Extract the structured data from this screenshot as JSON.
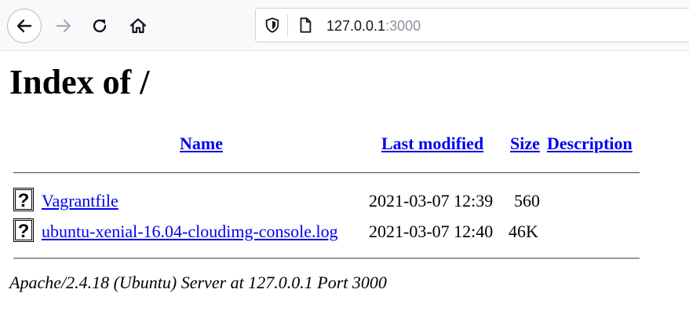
{
  "browser": {
    "url_host": "127.0.0.1",
    "url_port": ":3000",
    "icons": [
      "back-arrow-icon",
      "forward-arrow-icon",
      "reload-icon",
      "home-icon",
      "shield-icon",
      "page-icon"
    ]
  },
  "page": {
    "title": "Index of /",
    "columns": {
      "name": "Name",
      "last_modified": "Last modified",
      "size": "Size",
      "description": "Description"
    },
    "rows": [
      {
        "name": "Vagrantfile",
        "last_modified": "2021-03-07 12:39",
        "size": "560",
        "description": "",
        "icon": "unknown-file-icon"
      },
      {
        "name": "ubuntu-xenial-16.04-cloudimg-console.log",
        "last_modified": "2021-03-07 12:40",
        "size": "46K",
        "description": "",
        "icon": "unknown-file-icon"
      }
    ],
    "footer": "Apache/2.4.18 (Ubuntu) Server at 127.0.0.1 Port 3000"
  },
  "colors": {
    "link": "#0000ee",
    "toolbar_bg": "#f9f9fb",
    "url_port": "#8f8f9d"
  }
}
